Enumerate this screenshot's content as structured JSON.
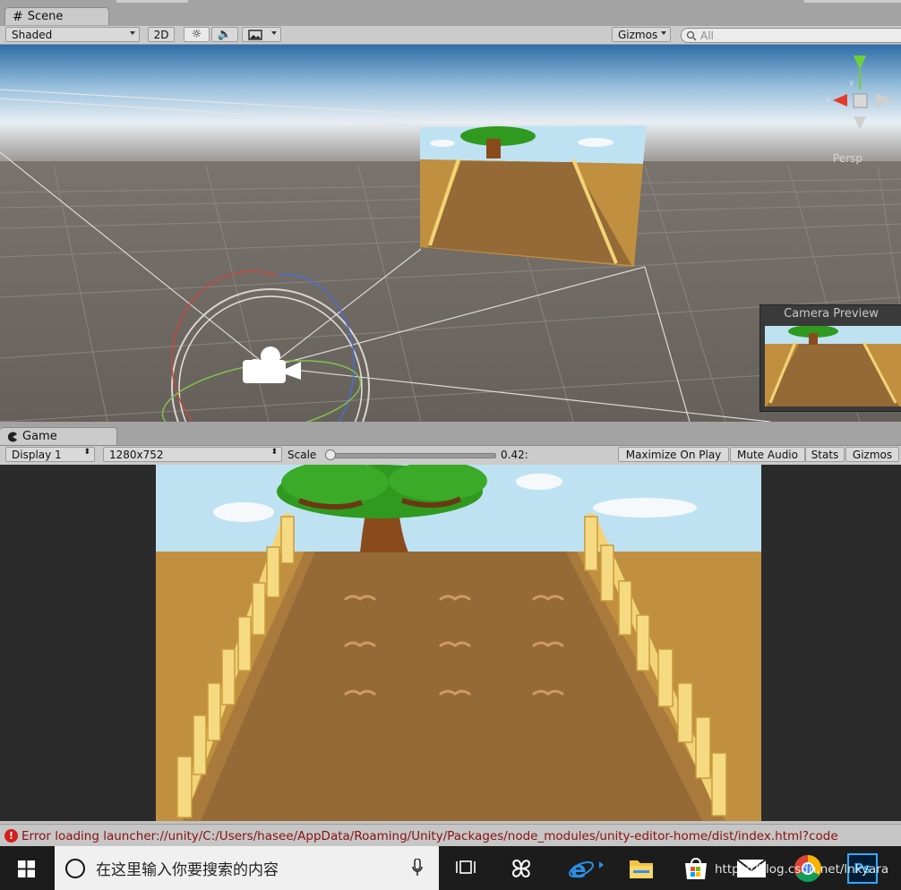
{
  "scene_panel": {
    "tab_label": "Scene",
    "shading_mode": "Shaded",
    "mode_2d": "2D",
    "gizmos_label": "Gizmos",
    "search_placeholder": "All",
    "persp_label": "Persp",
    "camera_preview_title": "Camera Preview",
    "axis_x": "x",
    "axis_y": "y"
  },
  "game_panel": {
    "tab_label": "Game",
    "display_select": "Display 1",
    "resolution_select": "1280x752",
    "scale_label": "Scale",
    "scale_value_text": "0.42:",
    "scale_slider_value": 0.0,
    "maximize_label": "Maximize On Play",
    "mute_label": "Mute Audio",
    "stats_label": "Stats",
    "gizmos_label": "Gizmos"
  },
  "status_bar": {
    "message": "Error loading launcher://unity/C:/Users/hasee/AppData/Roaming/Unity/Packages/node_modules/unity-editor-home/dist/index.html?code"
  },
  "taskbar": {
    "search_placeholder": "在这里输入你要搜索的内容",
    "watermark": "https://blog.csdn.net/lnkyara",
    "apps": [
      "task-view",
      "pinwheel",
      "internet-explorer",
      "file-explorer",
      "store",
      "mail",
      "chrome",
      "photoshop"
    ],
    "photoshop_label": "Ps"
  },
  "colors": {
    "sky": "#bfe2f3",
    "ground": "#c09040",
    "road": "#956a36",
    "fence": "#f2d477",
    "tree_leaves": "#2f9a1f",
    "tree_trunk": "#8a4b1c",
    "error_red": "#d21f1f",
    "error_text": "#8a1010"
  }
}
